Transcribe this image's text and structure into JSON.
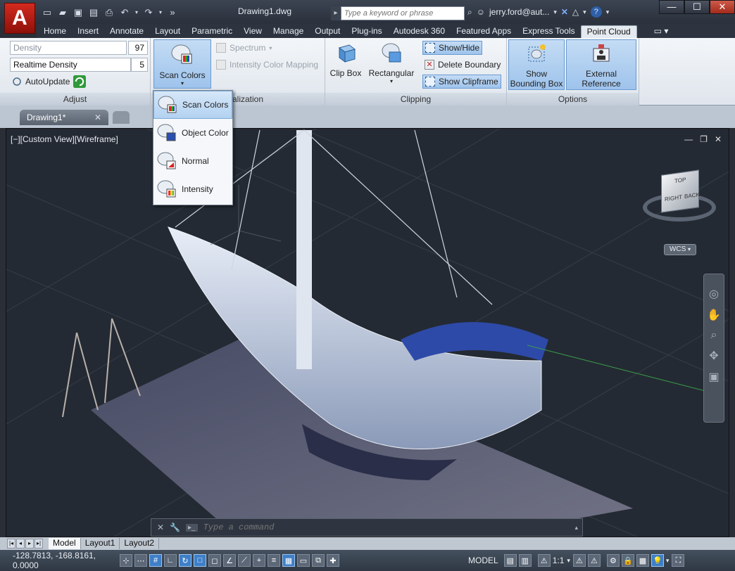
{
  "window": {
    "title": "Drawing1.dwg",
    "user": "jerry.ford@aut...",
    "search_placeholder": "Type a keyword or phrase",
    "app_logo": "A"
  },
  "ribbon_tabs": [
    "Home",
    "Insert",
    "Annotate",
    "Layout",
    "Parametric",
    "View",
    "Manage",
    "Output",
    "Plug-ins",
    "Autodesk 360",
    "Featured Apps",
    "Express Tools",
    "Point Cloud"
  ],
  "active_tab": "Point Cloud",
  "adjust": {
    "density_label": "Density",
    "density_value": "97",
    "realtime_label": "Realtime Density",
    "realtime_value": "5",
    "autoupdate_label": "AutoUpdate",
    "title": "Adjust"
  },
  "visualization": {
    "scan_colors_label": "Scan Colors",
    "spectrum_label": "Spectrum",
    "intensity_mapping_label": "Intensity Color Mapping",
    "title": "alization"
  },
  "clipping": {
    "clip_box_label": "Clip Box",
    "rectangular_label": "Rectangular",
    "show_hide_label": "Show/Hide",
    "delete_boundary_label": "Delete Boundary",
    "show_clipframe_label": "Show Clipframe",
    "title": "Clipping"
  },
  "options": {
    "show_bbox_label_1": "Show",
    "show_bbox_label_2": "Bounding Box",
    "ext_ref_label": "External Reference",
    "title": "Options"
  },
  "dropdown": {
    "items": [
      "Scan Colors",
      "Object Color",
      "Normal",
      "Intensity"
    ],
    "selected": "Scan Colors"
  },
  "file_tab": {
    "name": "Drawing1*"
  },
  "viewport": {
    "label": "[−][Custom View][Wireframe]",
    "viewcube_top": "TOP",
    "viewcube_right": "RIGHT",
    "viewcube_back": "BACK",
    "wcs": "WCS"
  },
  "command": {
    "placeholder": "Type a command"
  },
  "layout_tabs": [
    "Model",
    "Layout1",
    "Layout2"
  ],
  "status": {
    "coords": "-128.7813, -168.8161, 0.0000",
    "model": "MODEL",
    "scale": "1:1"
  },
  "colors": {
    "accent": "#3f7fc8",
    "logo_red": "#c4241a",
    "background": "#242a33"
  }
}
